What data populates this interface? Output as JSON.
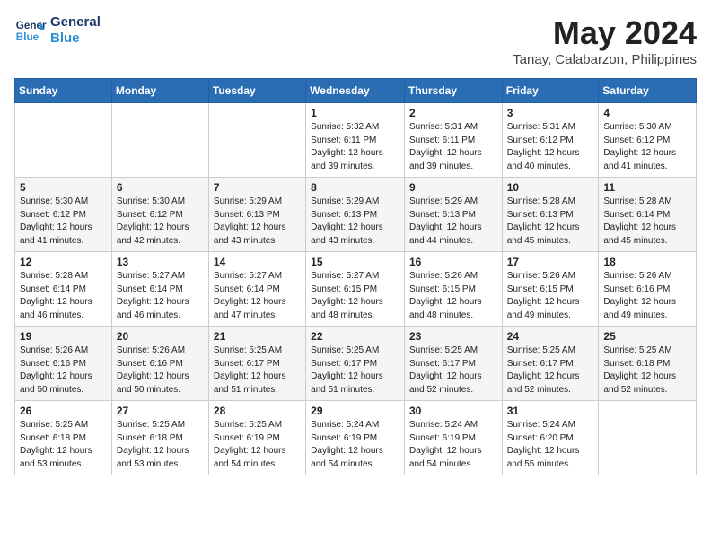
{
  "logo": {
    "line1": "General",
    "line2": "Blue"
  },
  "title": "May 2024",
  "subtitle": "Tanay, Calabarzon, Philippines",
  "header_days": [
    "Sunday",
    "Monday",
    "Tuesday",
    "Wednesday",
    "Thursday",
    "Friday",
    "Saturday"
  ],
  "weeks": [
    [
      {
        "day": "",
        "info": ""
      },
      {
        "day": "",
        "info": ""
      },
      {
        "day": "",
        "info": ""
      },
      {
        "day": "1",
        "info": "Sunrise: 5:32 AM\nSunset: 6:11 PM\nDaylight: 12 hours\nand 39 minutes."
      },
      {
        "day": "2",
        "info": "Sunrise: 5:31 AM\nSunset: 6:11 PM\nDaylight: 12 hours\nand 39 minutes."
      },
      {
        "day": "3",
        "info": "Sunrise: 5:31 AM\nSunset: 6:12 PM\nDaylight: 12 hours\nand 40 minutes."
      },
      {
        "day": "4",
        "info": "Sunrise: 5:30 AM\nSunset: 6:12 PM\nDaylight: 12 hours\nand 41 minutes."
      }
    ],
    [
      {
        "day": "5",
        "info": "Sunrise: 5:30 AM\nSunset: 6:12 PM\nDaylight: 12 hours\nand 41 minutes."
      },
      {
        "day": "6",
        "info": "Sunrise: 5:30 AM\nSunset: 6:12 PM\nDaylight: 12 hours\nand 42 minutes."
      },
      {
        "day": "7",
        "info": "Sunrise: 5:29 AM\nSunset: 6:13 PM\nDaylight: 12 hours\nand 43 minutes."
      },
      {
        "day": "8",
        "info": "Sunrise: 5:29 AM\nSunset: 6:13 PM\nDaylight: 12 hours\nand 43 minutes."
      },
      {
        "day": "9",
        "info": "Sunrise: 5:29 AM\nSunset: 6:13 PM\nDaylight: 12 hours\nand 44 minutes."
      },
      {
        "day": "10",
        "info": "Sunrise: 5:28 AM\nSunset: 6:13 PM\nDaylight: 12 hours\nand 45 minutes."
      },
      {
        "day": "11",
        "info": "Sunrise: 5:28 AM\nSunset: 6:14 PM\nDaylight: 12 hours\nand 45 minutes."
      }
    ],
    [
      {
        "day": "12",
        "info": "Sunrise: 5:28 AM\nSunset: 6:14 PM\nDaylight: 12 hours\nand 46 minutes."
      },
      {
        "day": "13",
        "info": "Sunrise: 5:27 AM\nSunset: 6:14 PM\nDaylight: 12 hours\nand 46 minutes."
      },
      {
        "day": "14",
        "info": "Sunrise: 5:27 AM\nSunset: 6:14 PM\nDaylight: 12 hours\nand 47 minutes."
      },
      {
        "day": "15",
        "info": "Sunrise: 5:27 AM\nSunset: 6:15 PM\nDaylight: 12 hours\nand 48 minutes."
      },
      {
        "day": "16",
        "info": "Sunrise: 5:26 AM\nSunset: 6:15 PM\nDaylight: 12 hours\nand 48 minutes."
      },
      {
        "day": "17",
        "info": "Sunrise: 5:26 AM\nSunset: 6:15 PM\nDaylight: 12 hours\nand 49 minutes."
      },
      {
        "day": "18",
        "info": "Sunrise: 5:26 AM\nSunset: 6:16 PM\nDaylight: 12 hours\nand 49 minutes."
      }
    ],
    [
      {
        "day": "19",
        "info": "Sunrise: 5:26 AM\nSunset: 6:16 PM\nDaylight: 12 hours\nand 50 minutes."
      },
      {
        "day": "20",
        "info": "Sunrise: 5:26 AM\nSunset: 6:16 PM\nDaylight: 12 hours\nand 50 minutes."
      },
      {
        "day": "21",
        "info": "Sunrise: 5:25 AM\nSunset: 6:17 PM\nDaylight: 12 hours\nand 51 minutes."
      },
      {
        "day": "22",
        "info": "Sunrise: 5:25 AM\nSunset: 6:17 PM\nDaylight: 12 hours\nand 51 minutes."
      },
      {
        "day": "23",
        "info": "Sunrise: 5:25 AM\nSunset: 6:17 PM\nDaylight: 12 hours\nand 52 minutes."
      },
      {
        "day": "24",
        "info": "Sunrise: 5:25 AM\nSunset: 6:17 PM\nDaylight: 12 hours\nand 52 minutes."
      },
      {
        "day": "25",
        "info": "Sunrise: 5:25 AM\nSunset: 6:18 PM\nDaylight: 12 hours\nand 52 minutes."
      }
    ],
    [
      {
        "day": "26",
        "info": "Sunrise: 5:25 AM\nSunset: 6:18 PM\nDaylight: 12 hours\nand 53 minutes."
      },
      {
        "day": "27",
        "info": "Sunrise: 5:25 AM\nSunset: 6:18 PM\nDaylight: 12 hours\nand 53 minutes."
      },
      {
        "day": "28",
        "info": "Sunrise: 5:25 AM\nSunset: 6:19 PM\nDaylight: 12 hours\nand 54 minutes."
      },
      {
        "day": "29",
        "info": "Sunrise: 5:24 AM\nSunset: 6:19 PM\nDaylight: 12 hours\nand 54 minutes."
      },
      {
        "day": "30",
        "info": "Sunrise: 5:24 AM\nSunset: 6:19 PM\nDaylight: 12 hours\nand 54 minutes."
      },
      {
        "day": "31",
        "info": "Sunrise: 5:24 AM\nSunset: 6:20 PM\nDaylight: 12 hours\nand 55 minutes."
      },
      {
        "day": "",
        "info": ""
      }
    ]
  ]
}
